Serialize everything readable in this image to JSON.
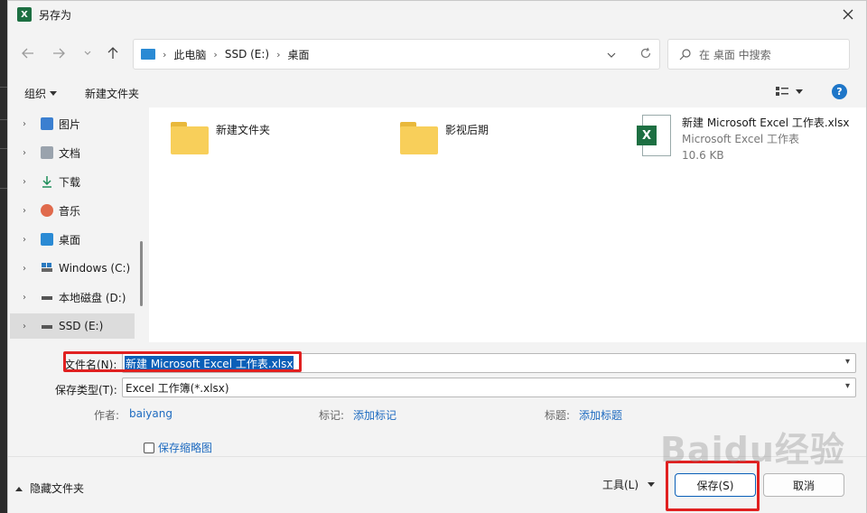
{
  "window": {
    "title": "另存为"
  },
  "nav": {
    "breadcrumbs": [
      "此电脑",
      "SSD (E:)",
      "桌面"
    ],
    "search_placeholder": "在 桌面 中搜索"
  },
  "toolbar": {
    "organize": "组织",
    "new_folder": "新建文件夹"
  },
  "sidebar": {
    "items": [
      {
        "label": "图片",
        "icon_color": "#3b7fd0"
      },
      {
        "label": "文档",
        "icon_color": "#9aa3ad"
      },
      {
        "label": "下载",
        "icon_color": "#1e8e5a"
      },
      {
        "label": "音乐",
        "icon_color": "#e06a4c"
      },
      {
        "label": "桌面",
        "icon_color": "#2a8ad4"
      },
      {
        "label": "Windows (C:)",
        "icon_color": "#2a7ac0"
      },
      {
        "label": "本地磁盘 (D:)",
        "icon_color": "#555555"
      },
      {
        "label": "SSD (E:)",
        "icon_color": "#555555"
      }
    ]
  },
  "files": [
    {
      "name": "新建文件夹"
    },
    {
      "name": "影视后期"
    },
    {
      "name": "新建 Microsoft Excel 工作表.xlsx",
      "type": "Microsoft Excel 工作表",
      "size": "10.6 KB"
    }
  ],
  "form": {
    "filename_label": "文件名(N):",
    "filename_value": "新建 Microsoft Excel 工作表.xlsx",
    "filetype_label": "保存类型(T):",
    "filetype_value": "Excel 工作簿(*.xlsx)",
    "author_label": "作者:",
    "author_value": "baiyang",
    "tags_label": "标记:",
    "tags_value": "添加标记",
    "title_label": "标题:",
    "title_value": "添加标题",
    "thumbnail_label": "保存缩略图"
  },
  "footer": {
    "hide_folders": "隐藏文件夹",
    "tools": "工具(L)",
    "save": "保存(S)",
    "cancel": "取消"
  },
  "watermark": "Baidu经验",
  "colors": {
    "accent": "#0a5fb8",
    "highlight": "#e02020",
    "excel_green": "#1d6f42"
  }
}
